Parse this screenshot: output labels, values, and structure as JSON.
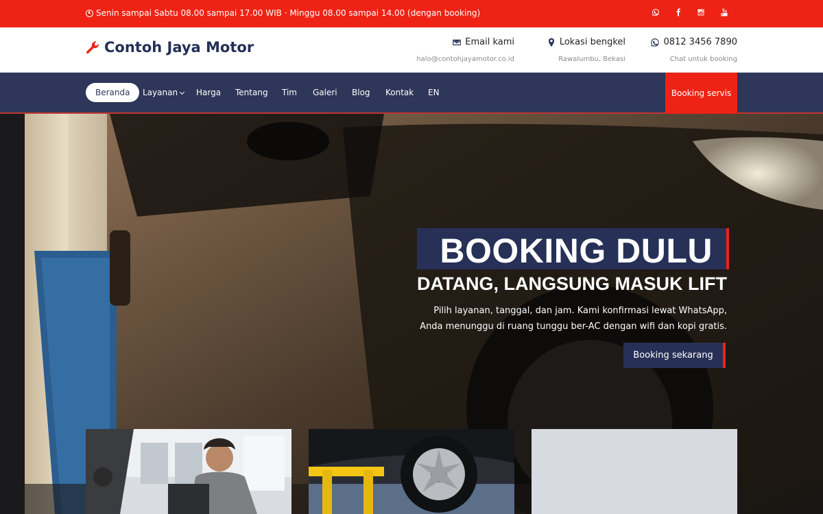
{
  "topbar": {
    "hours": "Senin sampai Sabtu 08.00 sampai 17.00 WIB · Minggu 08.00 sampai 14.00 (dengan booking)",
    "icons": [
      "clock-icon",
      "whatsapp-icon",
      "facebook-icon",
      "instagram-icon",
      "youtube-icon"
    ]
  },
  "header": {
    "brand": "Contoh Jaya Motor",
    "contacts": [
      {
        "title": "Email kami",
        "sub": "halo@contohjayamotor.co.id",
        "icon": "envelope-icon"
      },
      {
        "title": "Lokasi bengkel",
        "sub": "Rawalumbu, Bekasi",
        "icon": "map-marker-icon"
      },
      {
        "title": "0812 3456 7890",
        "sub": "Chat untuk booking",
        "icon": "whatsapp-icon"
      }
    ]
  },
  "nav": {
    "items": [
      "Beranda",
      "Layanan",
      "Harga",
      "Tentang",
      "Tim",
      "Galeri",
      "Blog",
      "Kontak",
      "EN"
    ],
    "active": "Beranda",
    "cta": "Booking servis"
  },
  "hero": {
    "headline": "BOOKING DULU",
    "subhead": "DATANG, LANGSUNG MASUK LIFT",
    "desc_line1": "Pilih layanan, tanggal, dan jam. Kami konfirmasi lewat WhatsApp,",
    "desc_line2": "Anda menunggu di ruang tunggu ber-AC dengan wifi dan kopi gratis.",
    "button": "Booking sekarang"
  },
  "colors": {
    "red": "#ee2315",
    "navy": "#2e3659",
    "brand_text": "#253057"
  }
}
